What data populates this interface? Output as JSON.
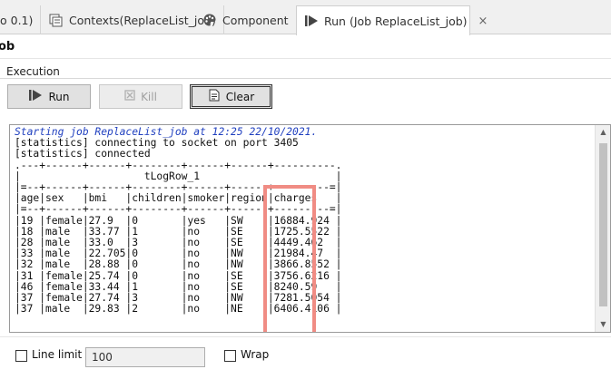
{
  "tabs": [
    {
      "label": "o 0.1)",
      "icon": "none"
    },
    {
      "label": "Contexts(ReplaceList_job)",
      "icon": "contexts-icon"
    },
    {
      "label": "Component",
      "icon": "palette-icon"
    },
    {
      "label": "Run (Job ReplaceList_job)",
      "icon": "run-icon",
      "active": true,
      "close": "×"
    }
  ],
  "job_title": "ob",
  "execution": {
    "label": "Execution",
    "run_label": "Run",
    "kill_label": "Kill",
    "clear_label": "Clear"
  },
  "console": {
    "status_line": "Starting job ReplaceList_job at 12:25 22/10/2021.",
    "body": "[statistics] connecting to socket on port 3405\n[statistics] connected\n.---+------+------+--------+------+------+----------.\n|                    tLogRow_1                      |\n|=--+------+------+--------+------+------+---------=|\n|age|sex   |bmi   |children|smoker|region|charges   |\n|=--+------+------+--------+------+------+---------=|\n|19 |female|27.9  |0       |yes   |SW    |16884.924 |\n|18 |male  |33.77 |1       |no    |SE    |1725.5522 |\n|28 |male  |33.0  |3       |no    |SE    |4449.462  |\n|33 |male  |22.705|0       |no    |NW    |21984.47  |\n|32 |male  |28.88 |0       |no    |NW    |3866.8552 |\n|31 |female|25.74 |0       |no    |SE    |3756.6216 |\n|46 |female|33.44 |1       |no    |SE    |8240.59   |\n|37 |female|27.74 |3       |no    |NW    |7281.5054 |\n|37 |male  |29.83 |2       |no    |NE    |6406.4106 |",
    "highlight_color": "#f08c84"
  },
  "bottom": {
    "line_limit_label": "Line limit",
    "line_limit_value": "100",
    "wrap_label": "Wrap"
  },
  "colors": {
    "status_text": "#1f3fbf",
    "highlight": "#f08c84"
  }
}
